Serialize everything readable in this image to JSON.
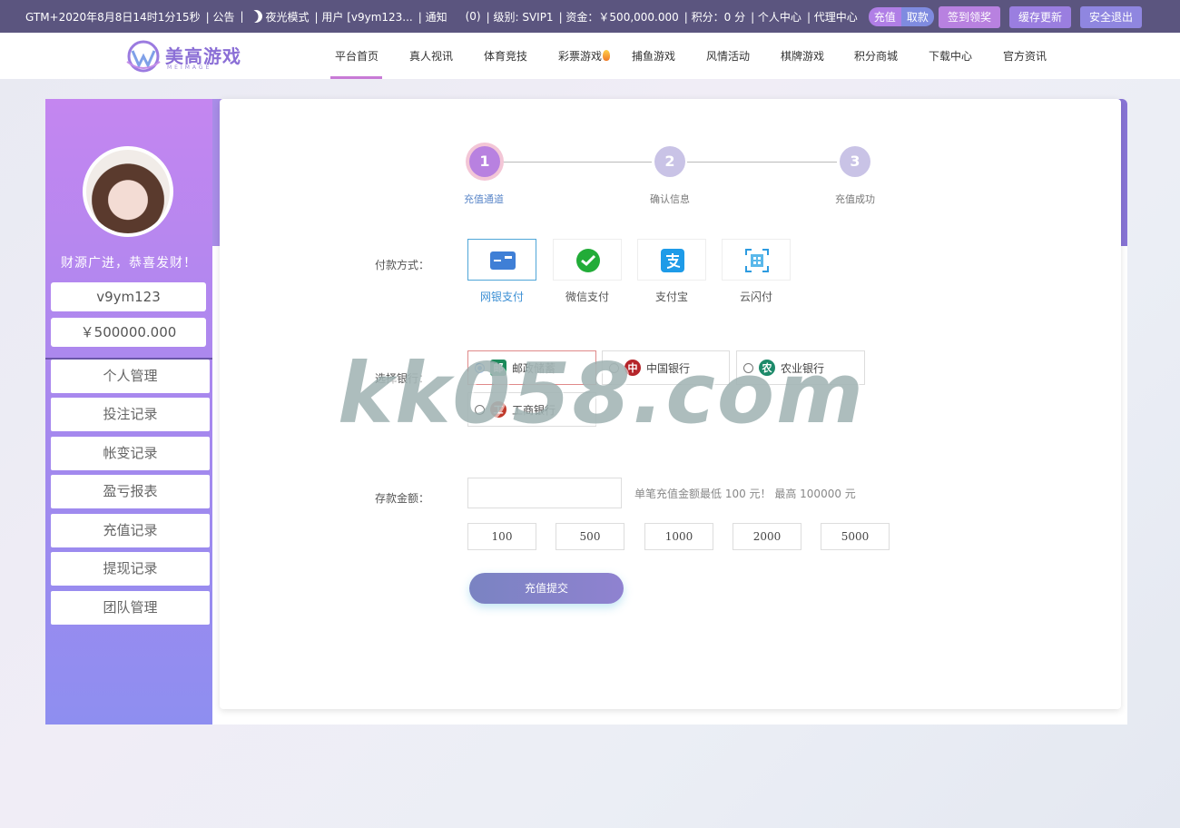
{
  "topbar": {
    "time": "GTM+2020年8月8日14时1分15秒",
    "notice": "| 公告",
    "sep1": "|",
    "night_mode": "夜光模式",
    "user": "| 用户 [v9ym123...",
    "notify": "| 通知",
    "notify_count": "(0)",
    "level": "| 级别: SVIP1",
    "funds": "| 资金：￥500,000.000",
    "points": "| 积分：0 分",
    "personal_center": "| 个人中心",
    "agent_center": "| 代理中心",
    "recharge": "充值",
    "withdraw": "取款",
    "signin_button": "签到领奖",
    "cache_button": "缓存更新",
    "logout_button": "安全退出",
    "colors": {
      "bar": "#5b557f",
      "signin": "#b881e0",
      "cache": "#9a7ee0",
      "logout": "#8f86e0"
    }
  },
  "logo": {
    "text": "美高游戏",
    "subtext": "MEIMAGE"
  },
  "nav": {
    "items": [
      "平台首页",
      "真人视讯",
      "体育竞技",
      "彩票游戏",
      "捕鱼游戏",
      "风情活动",
      "棋牌游戏",
      "积分商城",
      "下载中心",
      "官方资讯"
    ],
    "active_index": 0
  },
  "sidebar": {
    "slogan": "财源广进，恭喜发财！",
    "username": "v9ym123",
    "balance": "￥500000.000",
    "menu": [
      "个人管理",
      "投注记录",
      "帐变记录",
      "盈亏报表",
      "充值记录",
      "提现记录",
      "团队管理"
    ]
  },
  "steps": [
    {
      "num": "1",
      "label": "充值通道",
      "active": true
    },
    {
      "num": "2",
      "label": "确认信息",
      "active": false
    },
    {
      "num": "3",
      "label": "充值成功",
      "active": false
    }
  ],
  "form": {
    "payment_label": "付款方式：",
    "payment_methods": [
      {
        "label": "网银支付",
        "icon": "bank-card-icon",
        "selected": true
      },
      {
        "label": "微信支付",
        "icon": "wechat-icon",
        "selected": false
      },
      {
        "label": "支付宝",
        "icon": "alipay-icon",
        "selected": false
      },
      {
        "label": "云闪付",
        "icon": "unionpay-qr-icon",
        "selected": false
      }
    ],
    "bank_label": "选择银行：",
    "banks": [
      {
        "label": "邮政储蓄",
        "icon": "psbc-icon",
        "selected": true,
        "color": "#1b8a5a"
      },
      {
        "label": "中国银行",
        "icon": "boc-icon",
        "selected": false,
        "color": "#b5252a"
      },
      {
        "label": "农业银行",
        "icon": "abc-icon",
        "selected": false,
        "color": "#1d8a6a"
      },
      {
        "label": "工商银行",
        "icon": "icbc-icon",
        "selected": false,
        "color": "#c0392b"
      }
    ],
    "amount_label": "存款金额：",
    "amount_value": "",
    "amount_hint": "单笔充值金额最低 100 元！ 最高 100000 元",
    "quick_amounts": [
      "100",
      "500",
      "1000",
      "2000",
      "5000"
    ],
    "submit_label": "充值提交"
  },
  "watermark": "kk058.com"
}
